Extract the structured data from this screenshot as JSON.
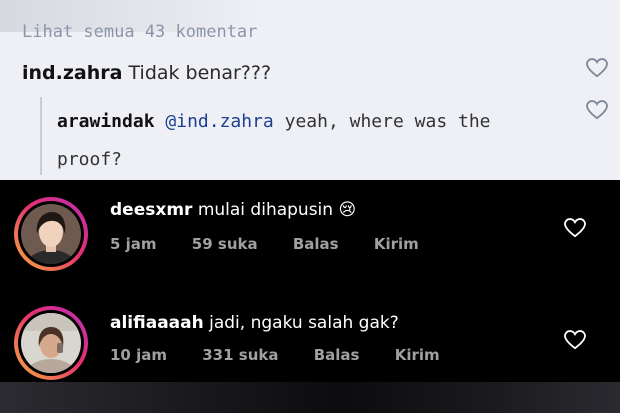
{
  "light_section": {
    "view_all_text": "Lihat semua 43 komentar",
    "comment1": {
      "username": "ind.zahra",
      "text": "Tidak benar???"
    },
    "reply1": {
      "username": "arawindak",
      "mention": "@ind.zahra",
      "text": "yeah, where was the proof?"
    }
  },
  "comments": [
    {
      "username": "deesxmr",
      "text": "mulai dihapusin 😢",
      "time": "5 jam",
      "likes": "59 suka",
      "reply_label": "Balas",
      "send_label": "Kirim"
    },
    {
      "username": "alifiaaaah",
      "text": "jadi, ngaku salah gak?",
      "time": "10 jam",
      "likes": "331 suka",
      "reply_label": "Balas",
      "send_label": "Kirim"
    }
  ],
  "colors": {
    "light_bg": "#eef0f6",
    "dark_bg": "#000000",
    "mention": "#1c3f8f",
    "heart_outline_light": "#7f8796",
    "story_ring_start": "#f9b13b",
    "story_ring_end": "#b72fbc"
  },
  "icons": [
    "heart-icon",
    "avatar",
    "story-ring"
  ]
}
